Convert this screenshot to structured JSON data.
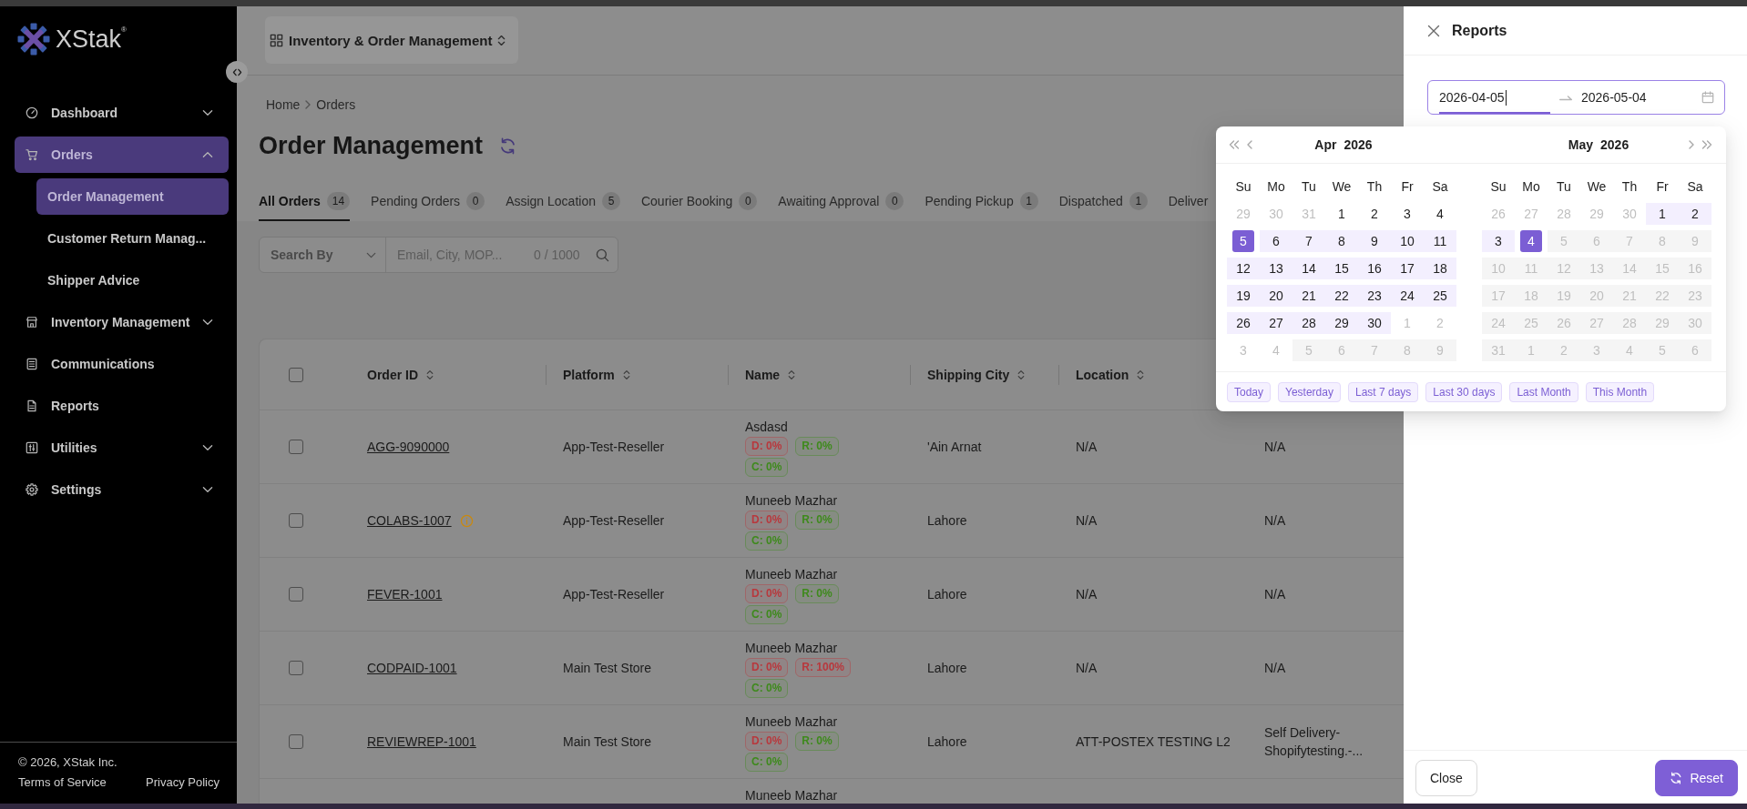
{
  "sidebar": {
    "logo": "XStak$^{®}$",
    "items": [
      {
        "label": "Dashboard",
        "expanded": false,
        "selected": false
      },
      {
        "label": "Orders",
        "expanded": true,
        "selected": true,
        "children": [
          {
            "label": "Order Management",
            "selected": true
          },
          {
            "label": "Customer Return Manag...",
            "selected": false
          },
          {
            "label": "Shipper Advice",
            "selected": false
          }
        ]
      },
      {
        "label": "Inventory Management",
        "expanded": false,
        "selected": false
      },
      {
        "label": "Communications",
        "selected": false
      },
      {
        "label": "Reports",
        "selected": false
      },
      {
        "label": "Utilities",
        "expanded": false,
        "selected": false
      },
      {
        "label": "Settings",
        "expanded": false,
        "selected": false
      }
    ],
    "footer": {
      "copyright": "© 2026, XStak Inc.",
      "links": [
        "Terms of Service",
        "Privacy Policy"
      ]
    }
  },
  "header": {
    "app_switcher": "Inventory & Order Management"
  },
  "breadcrumb": [
    "Home",
    "Orders"
  ],
  "page_title": "Order Management",
  "tabs": [
    {
      "label": "All Orders",
      "count": "14",
      "selected": true
    },
    {
      "label": "Pending Orders",
      "count": "0",
      "selected": false
    },
    {
      "label": "Assign Location",
      "count": "5",
      "selected": false
    },
    {
      "label": "Courier Booking",
      "count": "0",
      "selected": false
    },
    {
      "label": "Awaiting Approval",
      "count": "0",
      "selected": false
    },
    {
      "label": "Pending Pickup",
      "count": "1",
      "selected": false
    },
    {
      "label": "Dispatched",
      "count": "1",
      "selected": false
    },
    {
      "label": "Deliver",
      "selected": false
    }
  ],
  "search": {
    "field": "Search By",
    "placeholder": "Email, City, MOP...",
    "counter": "0 / 1000"
  },
  "table": {
    "select_all": {
      "checked": false
    },
    "columns": [
      "Order ID",
      "Platform",
      "Name",
      "Shipping City",
      "Location"
    ],
    "rows": [
      {
        "checked": false,
        "order_id": "AGG-9090000",
        "info": false,
        "platform": "App-Test-Reseller",
        "name": "Asdasd",
        "badges": [
          {
            "text": "D: 0%",
            "color": "#b8383d"
          },
          {
            "text": "R: 0%",
            "color": "#3e8a1c"
          },
          {
            "text": "C: 0%",
            "color": "#3e8a1c"
          }
        ],
        "shipping_city": "'Ain Arnat",
        "location": "N/A",
        "column_7": "N/A"
      },
      {
        "checked": false,
        "order_id": "COLABS-1007",
        "info": true,
        "platform": "App-Test-Reseller",
        "name": "Muneeb Mazhar",
        "badges": [
          {
            "text": "D: 0%",
            "color": "#b8383d"
          },
          {
            "text": "R: 0%",
            "color": "#3e8a1c"
          },
          {
            "text": "C: 0%",
            "color": "#3e8a1c"
          }
        ],
        "shipping_city": "Lahore",
        "location": "N/A",
        "column_7": "N/A"
      },
      {
        "checked": false,
        "order_id": "FEVER-1001",
        "info": false,
        "platform": "App-Test-Reseller",
        "name": "Muneeb Mazhar",
        "badges": [
          {
            "text": "D: 0%",
            "color": "#b8383d"
          },
          {
            "text": "R: 0%",
            "color": "#3e8a1c"
          },
          {
            "text": "C: 0%",
            "color": "#3e8a1c"
          }
        ],
        "shipping_city": "Lahore",
        "location": "N/A",
        "column_7": "N/A"
      },
      {
        "checked": false,
        "order_id": "CODPAID-1001",
        "info": false,
        "platform": "Main Test Store",
        "name": "Muneeb Mazhar",
        "badges": [
          {
            "text": "D: 0%",
            "color": "#b8383d"
          },
          {
            "text": "R: 100%",
            "color": "#b8383d"
          },
          {
            "text": "C: 0%",
            "color": "#3e8a1c"
          }
        ],
        "shipping_city": "Lahore",
        "location": "N/A",
        "column_7": "N/A"
      },
      {
        "checked": false,
        "order_id": "REVIEWREP-1001",
        "info": false,
        "platform": "Main Test Store",
        "name": "Muneeb Mazhar",
        "badges": [
          {
            "text": "D: 0%",
            "color": "#b8383d"
          },
          {
            "text": "R: 0%",
            "color": "#3e8a1c"
          },
          {
            "text": "C: 0%",
            "color": "#3e8a1c"
          }
        ],
        "shipping_city": "Lahore",
        "location": "ATT-POSTEX TESTING L2",
        "column_7": "Self Delivery-Shopifytesting.-..."
      },
      {
        "name": "Muneeb Mazhar"
      }
    ]
  },
  "drawer": {
    "title": "Reports",
    "date_range": {
      "start": {
        "value": "2026-04-05",
        "focused": true
      },
      "end": {
        "value": "2026-05-04",
        "focused": false
      }
    },
    "buttons": [
      {
        "label": "Close",
        "kind": "default"
      },
      {
        "label": "Reset",
        "kind": "primary"
      }
    ]
  },
  "date_picker": {
    "calendars": [
      {
        "month": "Apr",
        "year": "2026",
        "weekdays": [
          "Su",
          "Mo",
          "Tu",
          "We",
          "Th",
          "Fr",
          "Sa"
        ],
        "days": [
          {
            "day": "29",
            "kind": "outside",
            "selected": false
          },
          {
            "day": "30",
            "kind": "outside",
            "selected": false
          },
          {
            "day": "31",
            "kind": "outside",
            "selected": false
          },
          {
            "day": "1",
            "kind": "day",
            "selected": false
          },
          {
            "day": "2",
            "kind": "day",
            "selected": false
          },
          {
            "day": "3",
            "kind": "day",
            "selected": false
          },
          {
            "day": "4",
            "kind": "day",
            "selected": false
          },
          {
            "day": "5",
            "kind": "day",
            "selected": true
          },
          {
            "day": "6",
            "kind": "in_range",
            "selected": false
          },
          {
            "day": "7",
            "kind": "in_range",
            "selected": false
          },
          {
            "day": "8",
            "kind": "in_range",
            "selected": false
          },
          {
            "day": "9",
            "kind": "in_range",
            "selected": false
          },
          {
            "day": "10",
            "kind": "in_range",
            "selected": false
          },
          {
            "day": "11",
            "kind": "in_range",
            "selected": false
          },
          {
            "day": "12",
            "kind": "in_range",
            "selected": false
          },
          {
            "day": "13",
            "kind": "in_range",
            "selected": false
          },
          {
            "day": "14",
            "kind": "in_range",
            "selected": false
          },
          {
            "day": "15",
            "kind": "in_range",
            "selected": false
          },
          {
            "day": "16",
            "kind": "in_range",
            "selected": false
          },
          {
            "day": "17",
            "kind": "in_range",
            "selected": false
          },
          {
            "day": "18",
            "kind": "in_range",
            "selected": false
          },
          {
            "day": "19",
            "kind": "in_range",
            "selected": false
          },
          {
            "day": "20",
            "kind": "in_range",
            "selected": false
          },
          {
            "day": "21",
            "kind": "in_range",
            "selected": false
          },
          {
            "day": "22",
            "kind": "in_range",
            "selected": false
          },
          {
            "day": "23",
            "kind": "in_range",
            "selected": false
          },
          {
            "day": "24",
            "kind": "in_range",
            "selected": false
          },
          {
            "day": "25",
            "kind": "in_range",
            "selected": false
          },
          {
            "day": "26",
            "kind": "in_range",
            "selected": false
          },
          {
            "day": "27",
            "kind": "in_range",
            "selected": false
          },
          {
            "day": "28",
            "kind": "in_range",
            "selected": false
          },
          {
            "day": "29",
            "kind": "in_range",
            "selected": false
          },
          {
            "day": "30",
            "kind": "in_range",
            "selected": false
          },
          {
            "day": "1",
            "kind": "outside",
            "selected": false
          },
          {
            "day": "2",
            "kind": "outside",
            "selected": false
          },
          {
            "day": "3",
            "kind": "outside",
            "selected": false
          },
          {
            "day": "4",
            "kind": "outside",
            "selected": false
          },
          {
            "day": "5",
            "kind": "disabled",
            "selected": false
          },
          {
            "day": "6",
            "kind": "disabled",
            "selected": false
          },
          {
            "day": "7",
            "kind": "disabled",
            "selected": false
          },
          {
            "day": "8",
            "kind": "disabled",
            "selected": false
          },
          {
            "day": "9",
            "kind": "disabled",
            "selected": false
          }
        ]
      },
      {
        "month": "May",
        "year": "2026",
        "weekdays": [
          "Su",
          "Mo",
          "Tu",
          "We",
          "Th",
          "Fr",
          "Sa"
        ],
        "days": [
          {
            "day": "26",
            "kind": "outside",
            "selected": false
          },
          {
            "day": "27",
            "kind": "outside",
            "selected": false
          },
          {
            "day": "28",
            "kind": "outside",
            "selected": false
          },
          {
            "day": "29",
            "kind": "outside",
            "selected": false
          },
          {
            "day": "30",
            "kind": "outside",
            "selected": false
          },
          {
            "day": "1",
            "kind": "in_range",
            "selected": false
          },
          {
            "day": "2",
            "kind": "in_range",
            "selected": false
          },
          {
            "day": "3",
            "kind": "in_range",
            "selected": false
          },
          {
            "day": "4",
            "kind": "day",
            "selected": true
          },
          {
            "day": "5",
            "kind": "disabled",
            "selected": false
          },
          {
            "day": "6",
            "kind": "disabled",
            "selected": false
          },
          {
            "day": "7",
            "kind": "disabled",
            "selected": false
          },
          {
            "day": "8",
            "kind": "disabled",
            "selected": false
          },
          {
            "day": "9",
            "kind": "disabled",
            "selected": false
          },
          {
            "day": "10",
            "kind": "disabled",
            "selected": false
          },
          {
            "day": "11",
            "kind": "disabled",
            "selected": false
          },
          {
            "day": "12",
            "kind": "disabled",
            "selected": false
          },
          {
            "day": "13",
            "kind": "disabled",
            "selected": false
          },
          {
            "day": "14",
            "kind": "disabled",
            "selected": false
          },
          {
            "day": "15",
            "kind": "disabled",
            "selected": false
          },
          {
            "day": "16",
            "kind": "disabled",
            "selected": false
          },
          {
            "day": "17",
            "kind": "disabled",
            "selected": false
          },
          {
            "day": "18",
            "kind": "disabled",
            "selected": false
          },
          {
            "day": "19",
            "kind": "disabled",
            "selected": false
          },
          {
            "day": "20",
            "kind": "disabled",
            "selected": false
          },
          {
            "day": "21",
            "kind": "disabled",
            "selected": false
          },
          {
            "day": "22",
            "kind": "disabled",
            "selected": false
          },
          {
            "day": "23",
            "kind": "disabled",
            "selected": false
          },
          {
            "day": "24",
            "kind": "disabled",
            "selected": false
          },
          {
            "day": "25",
            "kind": "disabled",
            "selected": false
          },
          {
            "day": "26",
            "kind": "disabled",
            "selected": false
          },
          {
            "day": "27",
            "kind": "disabled",
            "selected": false
          },
          {
            "day": "28",
            "kind": "disabled",
            "selected": false
          },
          {
            "day": "29",
            "kind": "disabled",
            "selected": false
          },
          {
            "day": "30",
            "kind": "disabled",
            "selected": false
          },
          {
            "day": "31",
            "kind": "disabled",
            "selected": false
          },
          {
            "day": "1",
            "kind": "disabled",
            "selected": false
          },
          {
            "day": "2",
            "kind": "disabled",
            "selected": false
          },
          {
            "day": "3",
            "kind": "disabled",
            "selected": false
          },
          {
            "day": "4",
            "kind": "disabled",
            "selected": false
          },
          {
            "day": "5",
            "kind": "disabled",
            "selected": false
          },
          {
            "day": "6",
            "kind": "disabled",
            "selected": false
          }
        ]
      }
    ],
    "presets": [
      "Today",
      "Yesterday",
      "Last 7 days",
      "Last 30 days",
      "Last Month",
      "This Month"
    ]
  }
}
